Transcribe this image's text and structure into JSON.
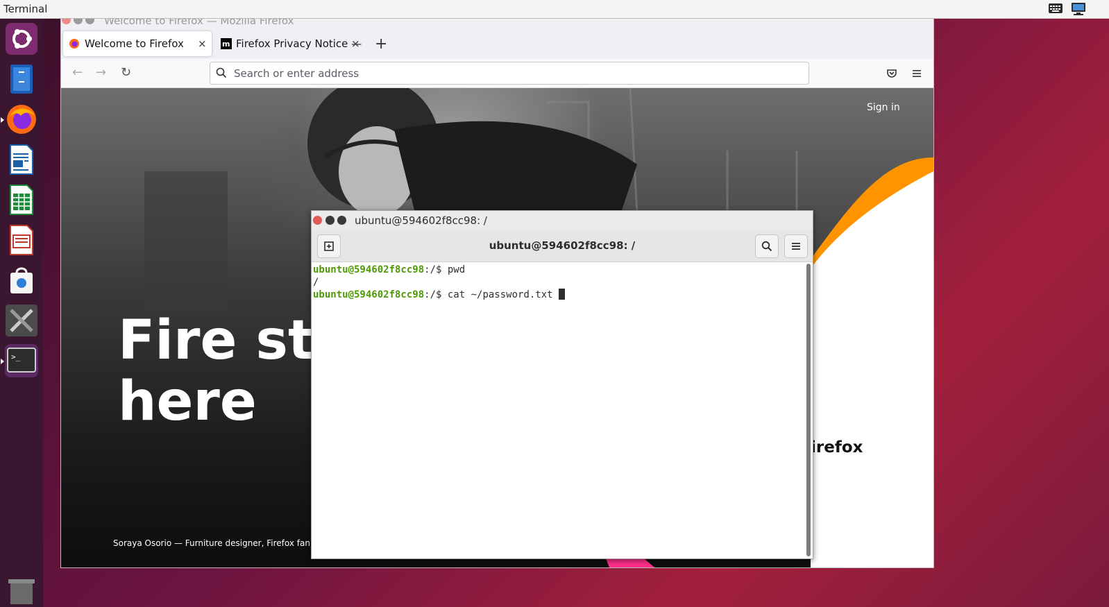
{
  "top_panel": {
    "app_name": "Terminal",
    "tray": [
      "keyboard-icon",
      "monitor-icon"
    ]
  },
  "dock": {
    "items": [
      {
        "name": "ubuntu-logo-icon"
      },
      {
        "name": "file-manager-icon"
      },
      {
        "name": "firefox-icon"
      },
      {
        "name": "writer-icon"
      },
      {
        "name": "calc-icon"
      },
      {
        "name": "impress-icon"
      },
      {
        "name": "software-store-icon"
      },
      {
        "name": "settings-tools-icon"
      },
      {
        "name": "terminal-icon"
      },
      {
        "name": "trash-icon"
      }
    ]
  },
  "firefox": {
    "window_title": "Welcome to Firefox — Mozilla Firefox",
    "tabs": [
      {
        "label": "Welcome to Firefox",
        "selected": true
      },
      {
        "label": "Firefox Privacy Notice —",
        "selected": false
      }
    ],
    "new_tab": "+",
    "close_glyph": "×",
    "url_placeholder": "Search or enter address",
    "page": {
      "sign_in": "Sign in",
      "headline_line1": "Fire sta",
      "headline_line2": "here",
      "side_text": "irefox",
      "caption": "Soraya Osorio — Furniture designer, Firefox fan",
      "accent_color": "#ff9400"
    }
  },
  "terminal": {
    "window_title": "ubuntu@594602f8cc98: /",
    "header_title": "ubuntu@594602f8cc98: /",
    "lines": [
      {
        "user": "ubuntu@594602f8cc98",
        "path": ":/$ ",
        "cmd": "pwd"
      },
      {
        "output": "/"
      },
      {
        "user": "ubuntu@594602f8cc98",
        "path": ":/$ ",
        "cmd": "cat ~/password.txt "
      }
    ],
    "prompt_color": "#4e9a06"
  }
}
